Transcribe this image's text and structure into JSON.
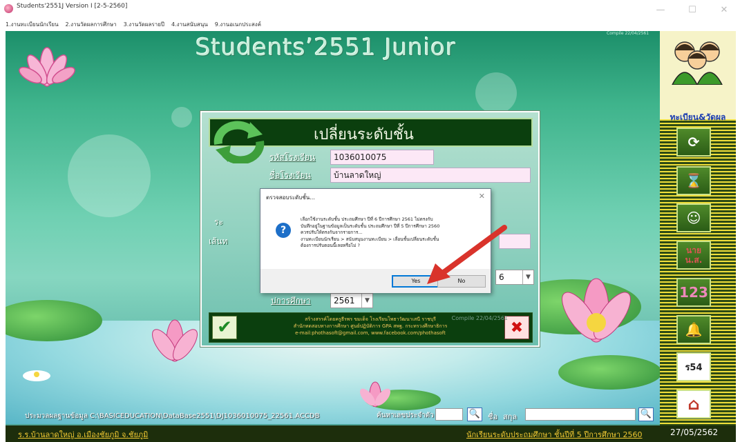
{
  "window": {
    "title": "Students'2551J Version I [2-5-2560]",
    "minimize_glyph": "—",
    "maximize_glyph": "☐",
    "close_glyph": "✕"
  },
  "menu": [
    "1.งานทะเบียนนักเรียน",
    "2.งานวัดผลการศึกษา",
    "3.งานวัดผลรายปี",
    "4.งานสนับสนุน",
    "9.งานอเนกประสงค์"
  ],
  "app": {
    "title": "Students’2551 Junior",
    "compile_small": "Compile 22/04/2561"
  },
  "sidebar": {
    "label": "ทะเบียน&วัดผล",
    "buttons": [
      "⟳",
      "⌛",
      "☺",
      "นาย น.ส.",
      "123",
      "🔔",
      "ร54",
      "⌂"
    ]
  },
  "dialog": {
    "title": "เปลี่ยนระดับชั้น",
    "school_code_label": "รหัสโรงเรียน",
    "school_code": "1036010075",
    "school_name_label": "ชื่อโรงเรียน",
    "school_name": "บ้านลาดใหญ่",
    "level_label_partial": "ระ",
    "path_label_partial": "เส้นท",
    "grade_value": "6",
    "year_label": "ปการศึกษา",
    "year_value": "2561",
    "footer_lines": [
      "สร้างสรรค์โดยครูธีรพร ขมเด็จ โรงเรียนโพธาวัฒนาเสนี ราชบุรี",
      "สำนักทดสอบทางการศึกษา ศูนย์ปฏิบัติการ GPA สพฐ. กระทรวงศึกษาธิการ",
      "e-mail:phothasoft@gmail.com, www.facebook.com/phothasoft"
    ],
    "compile": "Compile 22/04/2561",
    "ok_glyph": "✔",
    "cancel_glyph": "✖"
  },
  "message": {
    "title": "ตรวจสอบระดับชั้น...",
    "close_glyph": "✕",
    "icon_glyph": "?",
    "lines": [
      "เลือกใช้งานระดับชั้น ประถมศึกษา ปีที่ 6 ปีการศึกษา 2561 ไม่ตรงกับ",
      "บันทึกอยู่ในฐานข้อมูลเป็นระดับชั้น ประถมศึกษา ปีที่ 5 ปีการศึกษา 2560",
      "ควรปรับให้ตรงกันจากรายการ...",
      "งานทะเบียนนักเรียน > สนับสนุนงานทะเบียน > เลื่อนชั้นเปลี่ยนระดับชั้น",
      "ต้องการปรับตอนนี้เลยหรือไม่ ?"
    ],
    "yes": "Yes",
    "no": "No"
  },
  "search": {
    "db_path": "ประมวลผลฐานข้อมูล C:\\BASICEDUCATION\\DataBase2551\\DJ1036010075_22561.ACCDB",
    "id_label": "ค้นหาเลขประจำตัว",
    "name_label": "ชื่อ",
    "surname_label": "สกุล",
    "search_glyph": "🔍"
  },
  "status": {
    "school": "ร.ร.บ้านลาดใหญ่ อ.เมืองชัยภูมิ จ.ชัยภูมิ",
    "class_info": "นักเรียนระดับประถมศึกษา ชั้นปีที่ 5 ปีการศึกษา 2560",
    "date": "27/05/2562"
  },
  "colors": {
    "background": "#3fb48c",
    "sidebar": "#2d4a14",
    "sidebar_stripe": "#f0df3a",
    "dialog_header": "#0b3f0e",
    "status_text": "#f0c832",
    "arrow": "#d9332b"
  },
  "icons": {
    "app": "lotus-app-icon",
    "dialog": "refresh-arrows-icon",
    "message": "question-icon",
    "search": "search-icon"
  }
}
